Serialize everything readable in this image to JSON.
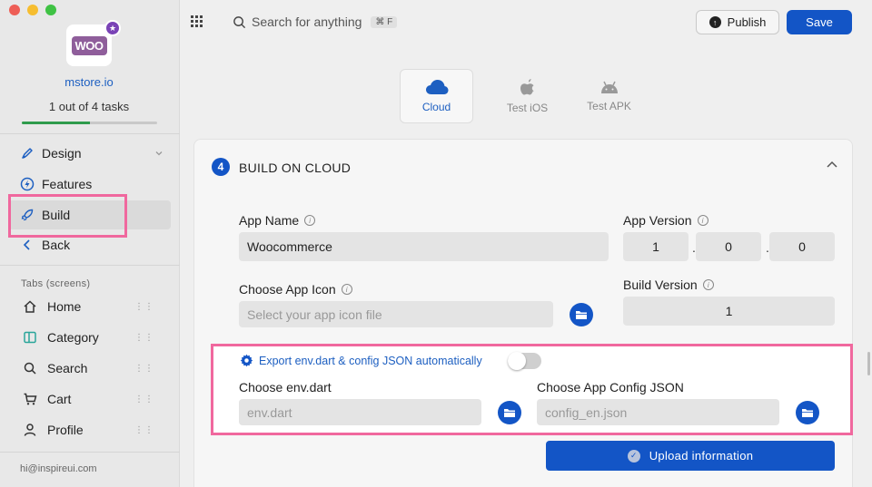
{
  "sidebar": {
    "store_name": "mstore.io",
    "tasks_text": "1 out of 4 tasks",
    "task_progress": 0.5,
    "logo_text": "WOO",
    "nav": [
      {
        "label": "Design",
        "icon": "design-pen-icon"
      },
      {
        "label": "Features",
        "icon": "lightning-icon"
      },
      {
        "label": "Build",
        "icon": "rocket-icon"
      },
      {
        "label": "Back",
        "icon": "chevron-left-icon"
      }
    ],
    "tabs_section_label": "Tabs (screens)",
    "tabs": [
      {
        "label": "Home",
        "icon": "home-icon"
      },
      {
        "label": "Category",
        "icon": "category-icon"
      },
      {
        "label": "Search",
        "icon": "search-icon"
      },
      {
        "label": "Cart",
        "icon": "cart-icon"
      },
      {
        "label": "Profile",
        "icon": "profile-icon"
      }
    ],
    "email": "hi@inspireui.com"
  },
  "topbar": {
    "search_placeholder": "Search for anything",
    "search_shortcut": "⌘ F",
    "publish_label": "Publish",
    "save_label": "Save"
  },
  "targets": [
    {
      "label": "Cloud",
      "icon": "cloud-icon",
      "active": true
    },
    {
      "label": "Test iOS",
      "icon": "apple-icon",
      "active": false
    },
    {
      "label": "Test APK",
      "icon": "android-icon",
      "active": false
    }
  ],
  "build": {
    "step_number": "4",
    "title": "BUILD ON CLOUD",
    "app_name_label": "App Name",
    "app_name_value": "Woocommerce",
    "app_version_label": "App Version",
    "version_major": "1",
    "version_minor": "0",
    "version_patch": "0",
    "version_sep": ".",
    "icon_label": "Choose App Icon",
    "icon_placeholder": "Select your app icon file",
    "build_version_label": "Build Version",
    "build_version_value": "1",
    "export_label": "Export env.dart & config JSON automatically",
    "export_enabled": false,
    "env_label": "Choose env.dart",
    "env_placeholder": "env.dart",
    "config_label": "Choose App Config JSON",
    "config_placeholder": "config_en.json",
    "upload_label": "Upload information"
  },
  "colors": {
    "accent": "#1355c6",
    "highlight": "#f0689e",
    "progress": "#2f9b4c"
  }
}
